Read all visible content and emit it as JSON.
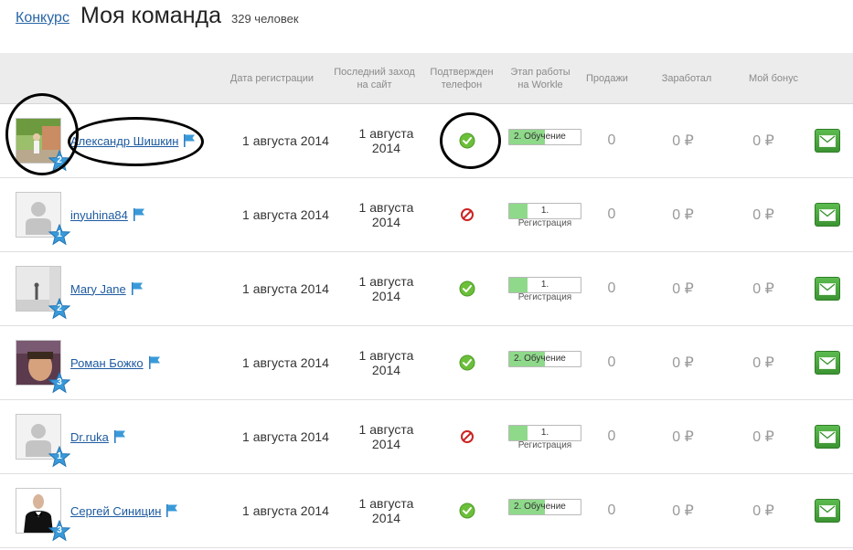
{
  "breadcrumb": {
    "link": "Конкурс"
  },
  "page": {
    "title": "Моя команда",
    "count": "329 человек"
  },
  "columns": {
    "reg_date": "Дата регистрации",
    "last_visit": "Последний заход на сайт",
    "phone": "Подтвержден телефон",
    "stage": "Этап работы на Workle",
    "sales": "Продажи",
    "earned": "Заработал",
    "bonus": "Мой бонус"
  },
  "rows": [
    {
      "name": "Александр Шишкин",
      "level": "2",
      "avatar": "photo-garden",
      "reg_date": "1 августа 2014",
      "last_visit": "1 августа 2014",
      "phone_status": "check-icon",
      "stage_label": "2. Обучение",
      "stage_sub": "",
      "stage_progress": 0.5,
      "sales": "0",
      "earned": "0 ₽",
      "bonus": "0 ₽"
    },
    {
      "name": "inyuhina84",
      "level": "1",
      "avatar": "placeholder",
      "reg_date": "1 августа 2014",
      "last_visit": "1 августа 2014",
      "phone_status": "forbidden-icon",
      "stage_label": "1.",
      "stage_sub": "Регистрация",
      "stage_progress": 0.25,
      "sales": "0",
      "earned": "0 ₽",
      "bonus": "0 ₽"
    },
    {
      "name": "Mary Jane",
      "level": "2",
      "avatar": "photo-room",
      "reg_date": "1 августа 2014",
      "last_visit": "1 августа 2014",
      "phone_status": "check-icon",
      "stage_label": "1.",
      "stage_sub": "Регистрация",
      "stage_progress": 0.25,
      "sales": "0",
      "earned": "0 ₽",
      "bonus": "0 ₽"
    },
    {
      "name": "Роман Божко",
      "level": "3",
      "avatar": "photo-face",
      "reg_date": "1 августа 2014",
      "last_visit": "1 августа 2014",
      "phone_status": "check-icon",
      "stage_label": "2. Обучение",
      "stage_sub": "",
      "stage_progress": 0.5,
      "sales": "0",
      "earned": "0 ₽",
      "bonus": "0 ₽"
    },
    {
      "name": "Dr.ruka",
      "level": "1",
      "avatar": "placeholder",
      "reg_date": "1 августа 2014",
      "last_visit": "1 августа 2014",
      "phone_status": "forbidden-icon",
      "stage_label": "1.",
      "stage_sub": "Регистрация",
      "stage_progress": 0.25,
      "sales": "0",
      "earned": "0 ₽",
      "bonus": "0 ₽"
    },
    {
      "name": "Сергей Синицин",
      "level": "3",
      "avatar": "photo-suit",
      "reg_date": "1 августа 2014",
      "last_visit": "1 августа 2014",
      "phone_status": "check-icon",
      "stage_label": "2. Обучение",
      "stage_sub": "",
      "stage_progress": 0.5,
      "sales": "0",
      "earned": "0 ₽",
      "bonus": "0 ₽"
    }
  ],
  "colors": {
    "link": "#1d5aa0",
    "header_bg": "#ececec",
    "stage_fill": "#8fd98a",
    "mail_button": "#4aa63f",
    "star": "#3a9ad9",
    "check": "#6cbf3a",
    "forbidden": "#cc2222"
  }
}
